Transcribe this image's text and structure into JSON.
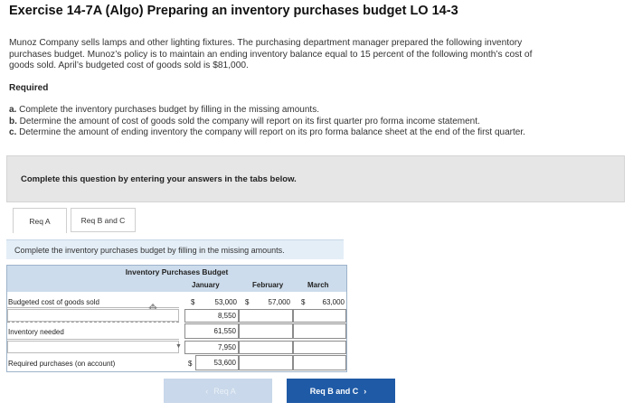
{
  "header": {
    "title": "Exercise 14-7A (Algo) Preparing an inventory purchases budget LO 14-3"
  },
  "intro": {
    "line1": "Munoz Company sells lamps and other lighting fixtures. The purchasing department manager prepared the following inventory",
    "line2": "purchases budget. Munoz’s policy is to maintain an ending inventory balance equal to 15 percent of the following month’s cost of",
    "line3": "goods sold. April’s budgeted cost of goods sold is $81,000."
  },
  "required": {
    "heading": "Required",
    "items": [
      {
        "letter": "a.",
        "text": " Complete the inventory purchases budget by filling in the missing amounts."
      },
      {
        "letter": "b.",
        "text": " Determine the amount of cost of goods sold the company will report on its first quarter pro forma income statement."
      },
      {
        "letter": "c.",
        "text": " Determine the amount of ending inventory the company will report on its pro forma balance sheet at the end of the first quarter."
      }
    ]
  },
  "instruction": "Complete this question by entering your answers in the tabs below.",
  "tabs": [
    {
      "label": "Req A",
      "active": true
    },
    {
      "label": "Req B and C",
      "active": false
    }
  ],
  "prompt": "Complete the inventory purchases budget by filling in the missing amounts.",
  "budget": {
    "title": "Inventory Purchases Budget",
    "months": [
      "January",
      "February",
      "March"
    ],
    "rows": {
      "cogs": {
        "label": "Budgeted cost of goods sold",
        "jan": "53,000",
        "feb": "57,000",
        "mar": "63,000"
      },
      "ending": {
        "label": "",
        "jan": "8,550",
        "feb": "",
        "mar": ""
      },
      "needed": {
        "label": "Inventory needed",
        "jan": "61,550",
        "feb": "",
        "mar": ""
      },
      "beginning": {
        "label": "",
        "jan": "7,950",
        "feb": "",
        "mar": ""
      },
      "purchases": {
        "label": "Required purchases (on account)",
        "jan": "53,600",
        "feb": "",
        "mar": ""
      }
    },
    "currency": "$"
  },
  "navigation": {
    "prev_label": "Req A",
    "next_label": "Req B and C"
  },
  "colors": {
    "accent": "#1f5aa6",
    "table_header": "#cddcec",
    "prompt_bar": "#e4eef7"
  }
}
